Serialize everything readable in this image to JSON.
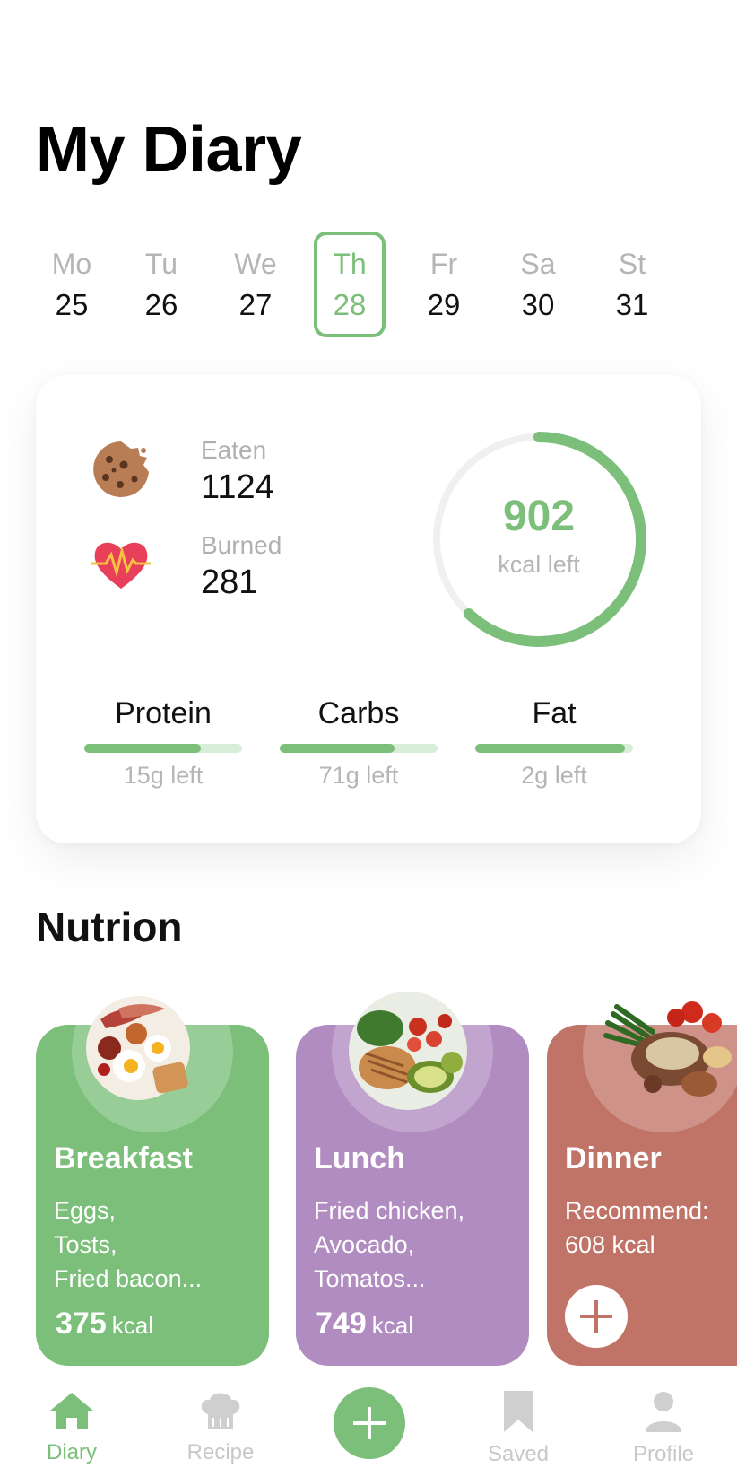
{
  "title": "My Diary",
  "week": [
    {
      "name": "Mo",
      "date": "25"
    },
    {
      "name": "Tu",
      "date": "26"
    },
    {
      "name": "We",
      "date": "27"
    },
    {
      "name": "Th",
      "date": "28"
    },
    {
      "name": "Fr",
      "date": "29"
    },
    {
      "name": "Sa",
      "date": "30"
    },
    {
      "name": "St",
      "date": "31"
    }
  ],
  "selected_day": "Th",
  "summary": {
    "eaten_label": "Eaten",
    "eaten_value": "1124",
    "burned_label": "Burned",
    "burned_value": "281",
    "kcal_left": "902",
    "kcal_left_label": "kcal left",
    "ring_progress": 0.62
  },
  "macros": [
    {
      "name": "Protein",
      "left": "15g left",
      "progress": 0.74
    },
    {
      "name": "Carbs",
      "left": "71g left",
      "progress": 0.73
    },
    {
      "name": "Fat",
      "left": "2g left",
      "progress": 0.95
    }
  ],
  "section_title": "Nutrion",
  "meals": {
    "breakfast": {
      "name": "Breakfast",
      "desc": [
        "Eggs,",
        "Tosts,",
        "Fried bacon..."
      ],
      "kcal": "375",
      "unit": "kcal"
    },
    "lunch": {
      "name": "Lunch",
      "desc": [
        "Fried chicken,",
        "Avocado,",
        "Tomatos..."
      ],
      "kcal": "749",
      "unit": "kcal"
    },
    "dinner": {
      "name": "Dinner",
      "desc": [
        "Recommend:",
        "608 kcal"
      ]
    }
  },
  "nav": {
    "diary": "Diary",
    "recipe": "Recipe",
    "saved": "Saved",
    "profile": "Profile"
  },
  "colors": {
    "accent": "#7cbf7a",
    "breakfast": "#7cbf7a",
    "lunch": "#b08cc0",
    "dinner": "#c07468"
  }
}
